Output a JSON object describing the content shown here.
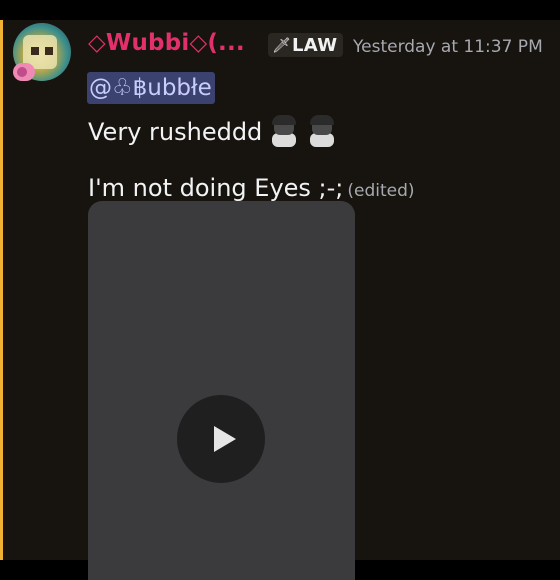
{
  "message": {
    "username": "◇Wubbi◇(...",
    "role_tag": {
      "icon": "sword-icon",
      "label": "LAW"
    },
    "timestamp": "Yesterday at 11:37 PM",
    "mention": "@♧฿ubbłe",
    "lines": [
      "Very rusheddd",
      "I'm not doing Eyes ;-;"
    ],
    "edited_label": "(edited)",
    "emojis": [
      "character-emoji",
      "character-emoji"
    ],
    "attachment": {
      "type": "video",
      "icon": "play-icon"
    }
  },
  "colors": {
    "background": "#17130e",
    "username": "#e2306c",
    "mention_bg": "#3c4270",
    "mention_text": "#c9cdfb",
    "highlight_bar": "#f0b232",
    "text": "#f2f3f5",
    "muted": "#a7a9b0"
  }
}
